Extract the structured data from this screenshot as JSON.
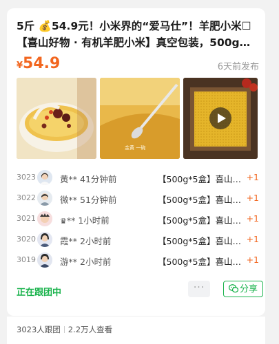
{
  "post": {
    "title_line1": "5斤 💰54.9元！小米界的“爱马仕”！羊肥小米☐",
    "title_line2": "【喜山好物 · 有机羊肥小米】真空包装，500g…",
    "price_currency": "¥",
    "price_value": "54.9",
    "posted_time": "6天前发布"
  },
  "gallery": {
    "image3_watermark": "",
    "image2_caption": "金黄 一碗"
  },
  "participants": [
    {
      "rank": "3023",
      "name": "黄**",
      "time": "41分钟前",
      "item": "【500g*5盒】喜山…",
      "qty": "+1"
    },
    {
      "rank": "3022",
      "name": "微**",
      "time": "51分钟前",
      "item": "【500g*5盒】喜山…",
      "qty": "+1"
    },
    {
      "rank": "3021",
      "name": "**",
      "time": "1小时前",
      "item": "【500g*5盒】喜山…",
      "qty": "+1"
    },
    {
      "rank": "3020",
      "name": "霞**",
      "time": "2小时前",
      "item": "【500g*5盒】喜山…",
      "qty": "+1"
    },
    {
      "rank": "3019",
      "name": "游**",
      "time": "2小时前",
      "item": "【500g*5盒】喜山…",
      "qty": "+1"
    }
  ],
  "actions": {
    "status": "正在跟团中",
    "more": "···",
    "share": "分享"
  },
  "footer": {
    "joined": "3023人跟团",
    "views": "2.2万人查看"
  },
  "colors": {
    "price": "#f2661f",
    "accent_green": "#17b24a"
  }
}
